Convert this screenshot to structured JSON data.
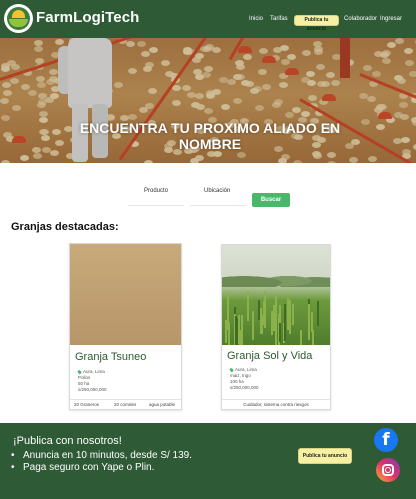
{
  "header": {
    "brand": "FarmLogiTech",
    "nav": {
      "inicio": "Inicio",
      "tarifas": "Tarifas",
      "publica": "Publica tu anuncio",
      "colaborador": "Colaborador",
      "ingresar": "Ingresar"
    }
  },
  "hero": {
    "title": "ENCUENTRA TU PROXIMO ALIADO EN NOMBRE"
  },
  "search": {
    "producto_label": "Producto",
    "ubicacion_label": "Ubicación",
    "producto_value": "",
    "ubicacion_value": "",
    "button": "Buscar"
  },
  "featured": {
    "title": "Granjas destacadas:",
    "cards": [
      {
        "name": "Granja Tsuneo",
        "location": "Aura, Lima",
        "details": [
          "Pollos",
          "50 ha",
          "s/250,000,000"
        ],
        "tags": [
          "20 Graneros",
          "20 corrales",
          "agua potable"
        ]
      },
      {
        "name": "Granja Sol y Vida",
        "location": "Aura, Lima",
        "details": [
          "maiz, trigo",
          "100 ha",
          "s/250,000,000"
        ],
        "tags": [
          "Cuidador, sistema contra riesgos"
        ]
      }
    ]
  },
  "footer": {
    "title": "¡Publica con nosotros!",
    "bullets": [
      "Anuncia en 10 minutos, desde S/ 139.",
      "Paga seguro con Yape o Plin."
    ],
    "cta": "Publica tu anuncio",
    "icons": [
      "facebook-icon",
      "instagram-icon"
    ]
  },
  "colors": {
    "header_bg": "#2e5a36",
    "accent_green": "#49b86a",
    "cta_yellow": "#f5f0a3",
    "card_title": "#2b5a30"
  }
}
